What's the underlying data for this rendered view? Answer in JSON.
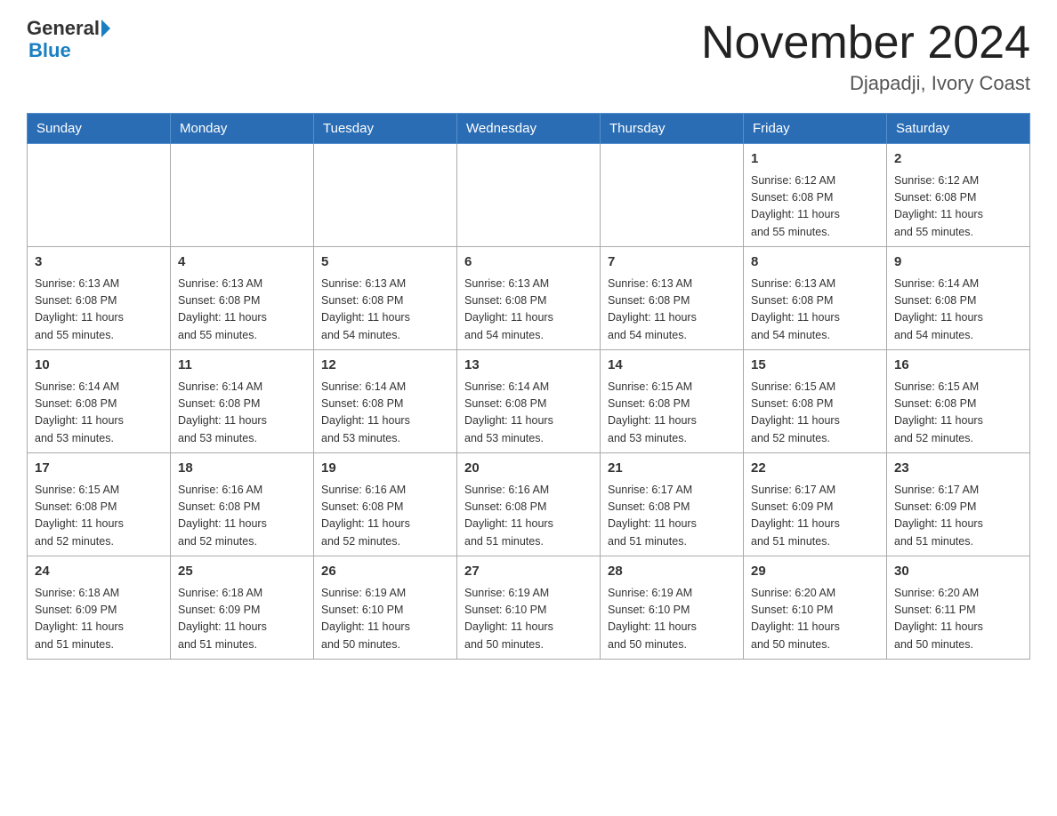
{
  "header": {
    "logo_line1": "General",
    "logo_line2": "Blue",
    "month_title": "November 2024",
    "location": "Djapadji, Ivory Coast"
  },
  "days_of_week": [
    "Sunday",
    "Monday",
    "Tuesday",
    "Wednesday",
    "Thursday",
    "Friday",
    "Saturday"
  ],
  "weeks": [
    {
      "days": [
        {
          "num": "",
          "info": ""
        },
        {
          "num": "",
          "info": ""
        },
        {
          "num": "",
          "info": ""
        },
        {
          "num": "",
          "info": ""
        },
        {
          "num": "",
          "info": ""
        },
        {
          "num": "1",
          "info": "Sunrise: 6:12 AM\nSunset: 6:08 PM\nDaylight: 11 hours\nand 55 minutes."
        },
        {
          "num": "2",
          "info": "Sunrise: 6:12 AM\nSunset: 6:08 PM\nDaylight: 11 hours\nand 55 minutes."
        }
      ]
    },
    {
      "days": [
        {
          "num": "3",
          "info": "Sunrise: 6:13 AM\nSunset: 6:08 PM\nDaylight: 11 hours\nand 55 minutes."
        },
        {
          "num": "4",
          "info": "Sunrise: 6:13 AM\nSunset: 6:08 PM\nDaylight: 11 hours\nand 55 minutes."
        },
        {
          "num": "5",
          "info": "Sunrise: 6:13 AM\nSunset: 6:08 PM\nDaylight: 11 hours\nand 54 minutes."
        },
        {
          "num": "6",
          "info": "Sunrise: 6:13 AM\nSunset: 6:08 PM\nDaylight: 11 hours\nand 54 minutes."
        },
        {
          "num": "7",
          "info": "Sunrise: 6:13 AM\nSunset: 6:08 PM\nDaylight: 11 hours\nand 54 minutes."
        },
        {
          "num": "8",
          "info": "Sunrise: 6:13 AM\nSunset: 6:08 PM\nDaylight: 11 hours\nand 54 minutes."
        },
        {
          "num": "9",
          "info": "Sunrise: 6:14 AM\nSunset: 6:08 PM\nDaylight: 11 hours\nand 54 minutes."
        }
      ]
    },
    {
      "days": [
        {
          "num": "10",
          "info": "Sunrise: 6:14 AM\nSunset: 6:08 PM\nDaylight: 11 hours\nand 53 minutes."
        },
        {
          "num": "11",
          "info": "Sunrise: 6:14 AM\nSunset: 6:08 PM\nDaylight: 11 hours\nand 53 minutes."
        },
        {
          "num": "12",
          "info": "Sunrise: 6:14 AM\nSunset: 6:08 PM\nDaylight: 11 hours\nand 53 minutes."
        },
        {
          "num": "13",
          "info": "Sunrise: 6:14 AM\nSunset: 6:08 PM\nDaylight: 11 hours\nand 53 minutes."
        },
        {
          "num": "14",
          "info": "Sunrise: 6:15 AM\nSunset: 6:08 PM\nDaylight: 11 hours\nand 53 minutes."
        },
        {
          "num": "15",
          "info": "Sunrise: 6:15 AM\nSunset: 6:08 PM\nDaylight: 11 hours\nand 52 minutes."
        },
        {
          "num": "16",
          "info": "Sunrise: 6:15 AM\nSunset: 6:08 PM\nDaylight: 11 hours\nand 52 minutes."
        }
      ]
    },
    {
      "days": [
        {
          "num": "17",
          "info": "Sunrise: 6:15 AM\nSunset: 6:08 PM\nDaylight: 11 hours\nand 52 minutes."
        },
        {
          "num": "18",
          "info": "Sunrise: 6:16 AM\nSunset: 6:08 PM\nDaylight: 11 hours\nand 52 minutes."
        },
        {
          "num": "19",
          "info": "Sunrise: 6:16 AM\nSunset: 6:08 PM\nDaylight: 11 hours\nand 52 minutes."
        },
        {
          "num": "20",
          "info": "Sunrise: 6:16 AM\nSunset: 6:08 PM\nDaylight: 11 hours\nand 51 minutes."
        },
        {
          "num": "21",
          "info": "Sunrise: 6:17 AM\nSunset: 6:08 PM\nDaylight: 11 hours\nand 51 minutes."
        },
        {
          "num": "22",
          "info": "Sunrise: 6:17 AM\nSunset: 6:09 PM\nDaylight: 11 hours\nand 51 minutes."
        },
        {
          "num": "23",
          "info": "Sunrise: 6:17 AM\nSunset: 6:09 PM\nDaylight: 11 hours\nand 51 minutes."
        }
      ]
    },
    {
      "days": [
        {
          "num": "24",
          "info": "Sunrise: 6:18 AM\nSunset: 6:09 PM\nDaylight: 11 hours\nand 51 minutes."
        },
        {
          "num": "25",
          "info": "Sunrise: 6:18 AM\nSunset: 6:09 PM\nDaylight: 11 hours\nand 51 minutes."
        },
        {
          "num": "26",
          "info": "Sunrise: 6:19 AM\nSunset: 6:10 PM\nDaylight: 11 hours\nand 50 minutes."
        },
        {
          "num": "27",
          "info": "Sunrise: 6:19 AM\nSunset: 6:10 PM\nDaylight: 11 hours\nand 50 minutes."
        },
        {
          "num": "28",
          "info": "Sunrise: 6:19 AM\nSunset: 6:10 PM\nDaylight: 11 hours\nand 50 minutes."
        },
        {
          "num": "29",
          "info": "Sunrise: 6:20 AM\nSunset: 6:10 PM\nDaylight: 11 hours\nand 50 minutes."
        },
        {
          "num": "30",
          "info": "Sunrise: 6:20 AM\nSunset: 6:11 PM\nDaylight: 11 hours\nand 50 minutes."
        }
      ]
    }
  ]
}
